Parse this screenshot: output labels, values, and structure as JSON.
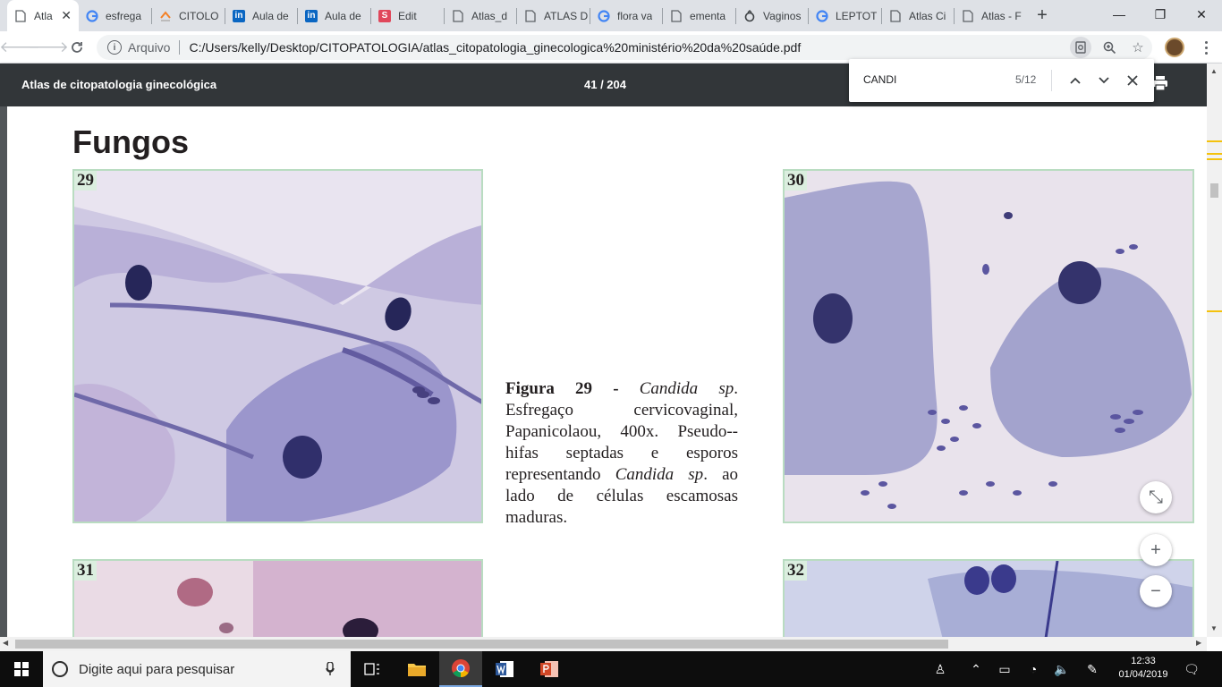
{
  "tabs": [
    {
      "label": "Atla",
      "icon": "pdf-doc-icon"
    },
    {
      "label": "esfrega",
      "icon": "google-icon"
    },
    {
      "label": "CITOLO",
      "icon": "stack-icon"
    },
    {
      "label": "Aula de",
      "icon": "linkedin-icon"
    },
    {
      "label": "Aula de",
      "icon": "linkedin-icon"
    },
    {
      "label": "Edit",
      "icon": "s-icon"
    },
    {
      "label": "Atlas_d",
      "icon": "pdf-doc-icon"
    },
    {
      "label": "ATLAS D",
      "icon": "pdf-doc-icon"
    },
    {
      "label": "flora va",
      "icon": "google-icon"
    },
    {
      "label": "ementa",
      "icon": "pdf-doc-icon"
    },
    {
      "label": "Vaginos",
      "icon": "loading-icon"
    },
    {
      "label": "LEPTOT",
      "icon": "google-icon"
    },
    {
      "label": "Atlas Ci",
      "icon": "pdf-doc-icon"
    },
    {
      "label": "Atlas - F",
      "icon": "pdf-doc-icon"
    }
  ],
  "new_tab_label": "+",
  "window": {
    "minimize": "—",
    "maximize": "❐",
    "close": "✕"
  },
  "address": {
    "scheme_label": "Arquivo",
    "url": "C:/Users/kelly/Desktop/CITOPATOLOGIA/atlas_citopatologia_ginecologica%20ministério%20da%20saúde.pdf"
  },
  "pdf": {
    "title": "Atlas de citopatologia ginecológica",
    "page_indicator": "41 / 204"
  },
  "find": {
    "query": "CANDI",
    "count": "5/12"
  },
  "document": {
    "heading": "Fungos",
    "figures": [
      {
        "number": "29"
      },
      {
        "number": "30"
      },
      {
        "number": "31"
      },
      {
        "number": "32"
      }
    ],
    "caption": {
      "figure_label": "Figura 29 -",
      "species1": "Candida sp",
      "part1": ". Esfregaço cervicovaginal, Papanicolaou, 400x. Pseudo--hifas septadas e esporos representando ",
      "species2": "Candida sp",
      "part2": ". ao lado de células escamosas maduras."
    }
  },
  "zoom": {
    "fit": "⤡",
    "in": "+",
    "out": "−"
  },
  "taskbar": {
    "search_placeholder": "Digite aqui para pesquisar",
    "time": "12:33",
    "date": "01/04/2019"
  },
  "colors": {
    "tabstrip": "#dee1e6",
    "pdf_toolbar": "#323639",
    "figure_border": "#b9dcc1",
    "figure_number_bg": "#dbeedf",
    "taskbar": "#0d0d0d",
    "scroll_marker": "#f4c20d"
  }
}
